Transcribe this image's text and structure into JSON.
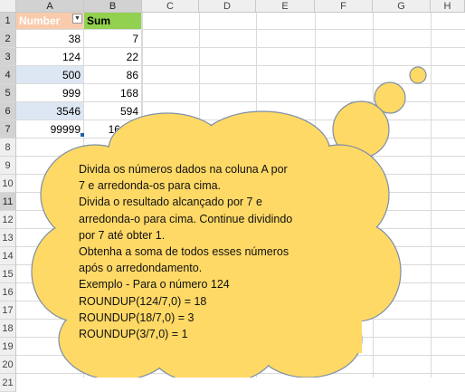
{
  "columns": [
    "A",
    "B",
    "C",
    "D",
    "E",
    "F",
    "G",
    "H"
  ],
  "rows": [
    "1",
    "2",
    "3",
    "4",
    "5",
    "6",
    "7",
    "8",
    "9",
    "10",
    "11",
    "12",
    "13",
    "14",
    "15",
    "16",
    "17",
    "18",
    "19",
    "20",
    "21"
  ],
  "header": {
    "a": "Number",
    "b": "Sum"
  },
  "table": [
    {
      "a": "38",
      "b": "7"
    },
    {
      "a": "124",
      "b": "22"
    },
    {
      "a": "500",
      "b": "86"
    },
    {
      "a": "999",
      "b": "168"
    },
    {
      "a": "3546",
      "b": "594"
    },
    {
      "a": "99999",
      "b": "16668"
    }
  ],
  "note": {
    "text": "Divida os números dados na coluna A por\n7 e arredonda-os para cima.\nDivida o resultado alcançado por 7 e\narredonda-o para cima. Continue dividindo\npor 7 até obter 1.\nObtenha a soma de todos esses números\napós o arredondamento.\nExemplo - Para o número 124\nROUNDUP(124/7,0) = 18\nROUNDUP(18/7,0) = 3\nROUNDUP(3/7,0) = 1"
  },
  "colors": {
    "cloud_fill": "#ffd966",
    "cloud_stroke": "#7d8ea6",
    "header_a": "#f8cbad",
    "header_b": "#92d050"
  }
}
